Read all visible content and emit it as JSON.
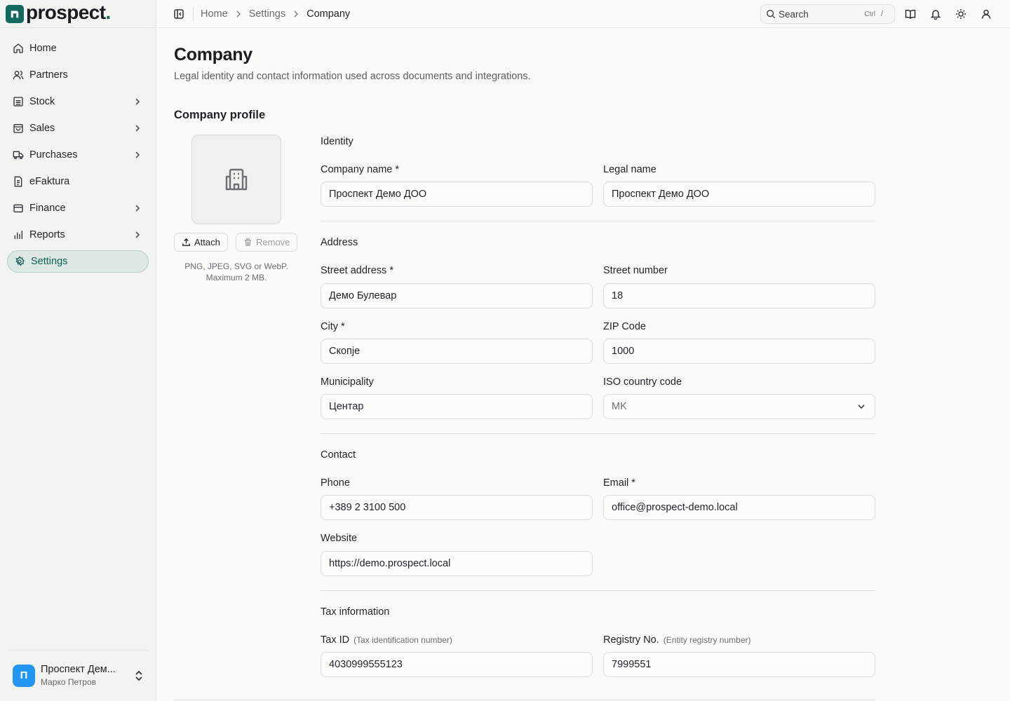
{
  "brand": {
    "name": "prospect",
    "dot": "."
  },
  "sidebar": {
    "items": [
      {
        "label": "Home",
        "icon": "home-icon",
        "chevron": false
      },
      {
        "label": "Partners",
        "icon": "users-icon",
        "chevron": true
      },
      {
        "label": "Stock",
        "icon": "warehouse-icon",
        "chevron": true
      },
      {
        "label": "Sales",
        "icon": "shopping-bag-icon",
        "chevron": true
      },
      {
        "label": "Purchases",
        "icon": "truck-icon",
        "chevron": true
      },
      {
        "label": "eFaktura",
        "icon": "document-icon",
        "chevron": false
      },
      {
        "label": "Finance",
        "icon": "wallet-icon",
        "chevron": true
      },
      {
        "label": "Reports",
        "icon": "bar-chart-icon",
        "chevron": true
      },
      {
        "label": "Settings",
        "icon": "gear-icon",
        "chevron": false,
        "active": true
      }
    ],
    "footer": {
      "avatar_letter": "П",
      "org_name": "Проспект Дем...",
      "user_name": "Марко Петров"
    }
  },
  "topbar": {
    "breadcrumb": [
      "Home",
      "Settings",
      "Company"
    ],
    "search": {
      "label": "Search",
      "shortcut_key": "Ctrl",
      "shortcut_char": "/"
    }
  },
  "page": {
    "title": "Company",
    "subtitle": "Legal identity and contact information used across documents and integrations.",
    "section_title": "Company profile",
    "logo": {
      "attach_label": "Attach",
      "remove_label": "Remove",
      "hint": "PNG, JPEG, SVG or WebP. Maximum 2 MB."
    }
  },
  "form": {
    "identity": {
      "title": "Identity",
      "company_name": {
        "label": "Company name *",
        "value": "Проспект Демо ДОО"
      },
      "legal_name": {
        "label": "Legal name",
        "value": "Проспект Демо ДОО"
      }
    },
    "address": {
      "title": "Address",
      "street_address": {
        "label": "Street address *",
        "value": "Демо Булевар"
      },
      "street_number": {
        "label": "Street number",
        "value": "18"
      },
      "city": {
        "label": "City *",
        "value": "Скопје"
      },
      "zip": {
        "label": "ZIP Code",
        "value": "1000"
      },
      "municipality": {
        "label": "Municipality",
        "value": "Центар"
      },
      "country": {
        "label": "ISO country code",
        "value": "MK"
      }
    },
    "contact": {
      "title": "Contact",
      "phone": {
        "label": "Phone",
        "value": "+389 2 3100 500"
      },
      "email": {
        "label": "Email *",
        "value": "office@prospect-demo.local"
      },
      "website": {
        "label": "Website",
        "value": "https://demo.prospect.local"
      }
    },
    "tax": {
      "title": "Tax information",
      "tax_id": {
        "label": "Tax ID",
        "note": "(Tax identification number)",
        "value": "4030999555123"
      },
      "registry": {
        "label": "Registry No.",
        "note": "(Entity registry number)",
        "value": "7999551"
      }
    }
  },
  "colors": {
    "accent": "#14695e",
    "active_bg": "#dde7e4",
    "avatar": "#2196f3"
  }
}
